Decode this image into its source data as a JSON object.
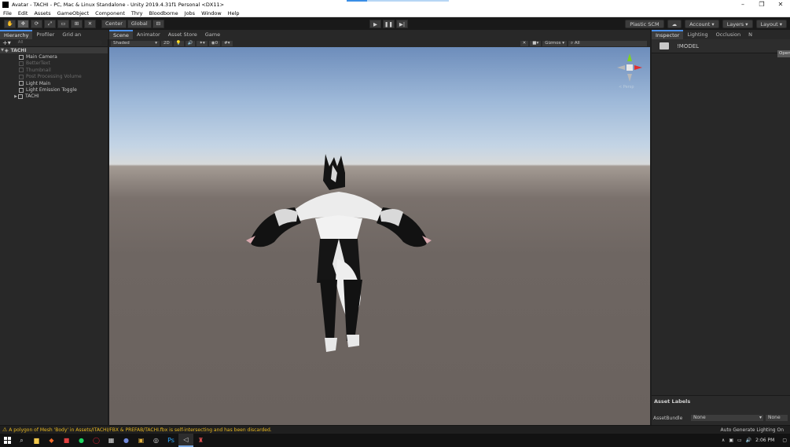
{
  "window": {
    "title": "Avatar - TACHI - PC, Mac & Linux Standalone - Unity 2019.4.31f1 Personal <DX11>",
    "controls": [
      "–",
      "❐",
      "✕"
    ]
  },
  "menu": [
    "File",
    "Edit",
    "Assets",
    "GameObject",
    "Component",
    "Thry",
    "Bloodborne",
    "Jobs",
    "Window",
    "Help"
  ],
  "toolbar": {
    "pivot": "Center",
    "space": "Global",
    "plastic": "Plastic SCM",
    "account": "Account",
    "layers": "Layers",
    "layout": "Layout"
  },
  "left_tabs": [
    "Hierarchy",
    "Profiler",
    "Grid an"
  ],
  "center_tabs": [
    "Scene",
    "Animator",
    "Asset Store",
    "Game"
  ],
  "right_tabs": [
    "Inspector",
    "Lighting",
    "Occlusion",
    "N"
  ],
  "hierarchy": {
    "search_placeholder": "All",
    "items": [
      {
        "label": "TACHI",
        "state": "root"
      },
      {
        "label": "Main Camera",
        "state": "normal"
      },
      {
        "label": "BetterText",
        "state": "disabled"
      },
      {
        "label": "Thumbnail",
        "state": "disabled"
      },
      {
        "label": "Post Processing Volume",
        "state": "disabled"
      },
      {
        "label": "Light Main",
        "state": "normal"
      },
      {
        "label": "Light Emission Toggle",
        "state": "normal"
      },
      {
        "label": "TACHI",
        "state": "collapsed"
      }
    ]
  },
  "scene_bar": {
    "shading": "Shaded",
    "mode_2d": "2D",
    "fx_count": "0",
    "gizmos": "Gizmos",
    "search": "All"
  },
  "gizmo": {
    "label": "< Persp",
    "axis_y": "y"
  },
  "inspector": {
    "asset_name": "!MODEL",
    "open_label": "Open",
    "asset_labels_title": "Asset Labels",
    "asset_bundle_label": "AssetBundle",
    "asset_bundle_value": "None",
    "asset_variant_value": "None"
  },
  "status": {
    "warning": "A polygon of Mesh 'Body' in Assets/ITACHI/FBX & PREFAB/TACHI.fbx is self-intersecting and has been discarded.",
    "right": "Auto Generate Lighting On"
  },
  "taskbar": {
    "clock": "2:06 PM",
    "icons": [
      "search",
      "folder",
      "brave",
      "media",
      "spotify",
      "opera",
      "photos",
      "discord",
      "launcher",
      "steam",
      "photoshop",
      "unity",
      "app"
    ]
  }
}
